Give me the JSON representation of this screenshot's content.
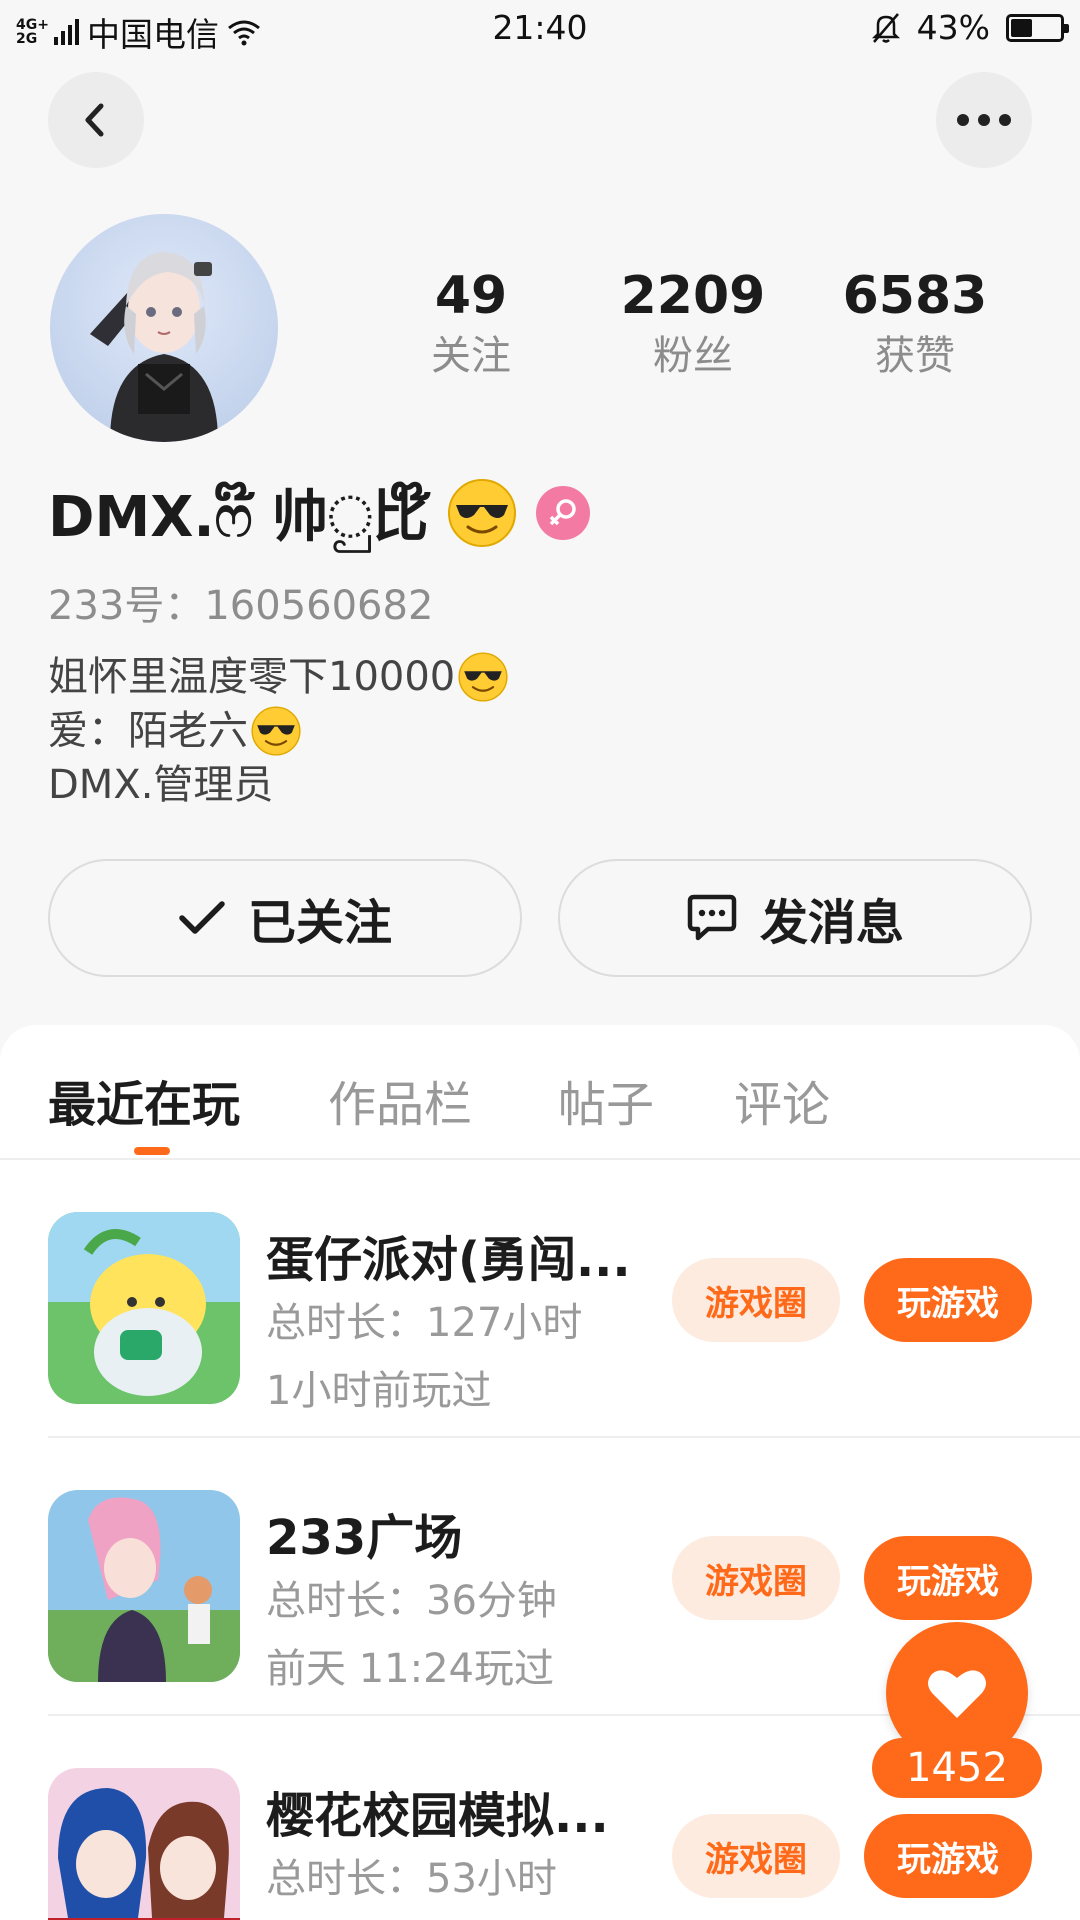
{
  "status_bar": {
    "network": "4G+\n2G",
    "carrier": "中国电信",
    "time": "21:40",
    "battery": "43%",
    "battery_level": 0.43
  },
  "icons": {
    "back": "chevron-left-icon",
    "more": "more-dots-icon",
    "gender": "female-icon",
    "follow_check": "check-icon",
    "message": "chat-bubble-icon",
    "like": "heart-icon"
  },
  "colors": {
    "accent": "#ff6a1a",
    "accent_light": "#fdebdf",
    "gender_pink": "#f37aa3"
  },
  "profile": {
    "stats": [
      {
        "value": "49",
        "label": "关注"
      },
      {
        "value": "2209",
        "label": "粉丝"
      },
      {
        "value": "6583",
        "label": "获赞"
      }
    ],
    "nickname": "DMX.ෆ໊ 帅ු比໊",
    "uid": "233号：160560682",
    "bio": [
      "姐怀里温度零下10000",
      "爱：陌老六",
      "DMX.管理员"
    ],
    "follow_label": "已关注",
    "message_label": "发消息"
  },
  "tabs": [
    {
      "label": "最近在玩",
      "active": true
    },
    {
      "label": "作品栏",
      "active": false
    },
    {
      "label": "帖子",
      "active": false
    },
    {
      "label": "评论",
      "active": false
    }
  ],
  "games": [
    {
      "title": "蛋仔派对(勇闯...",
      "duration": "总时长：127小时",
      "last_played": "1小时前玩过",
      "circle_label": "游戏圈",
      "play_label": "玩游戏"
    },
    {
      "title": "233广场",
      "duration": "总时长：36分钟",
      "last_played": "前天 11:24玩过",
      "circle_label": "游戏圈",
      "play_label": "玩游戏"
    },
    {
      "title": "樱花校园模拟...",
      "duration": "总时长：53小时",
      "last_played": "",
      "circle_label": "游戏圈",
      "play_label": "玩游戏"
    }
  ],
  "like": {
    "count": "1452"
  }
}
